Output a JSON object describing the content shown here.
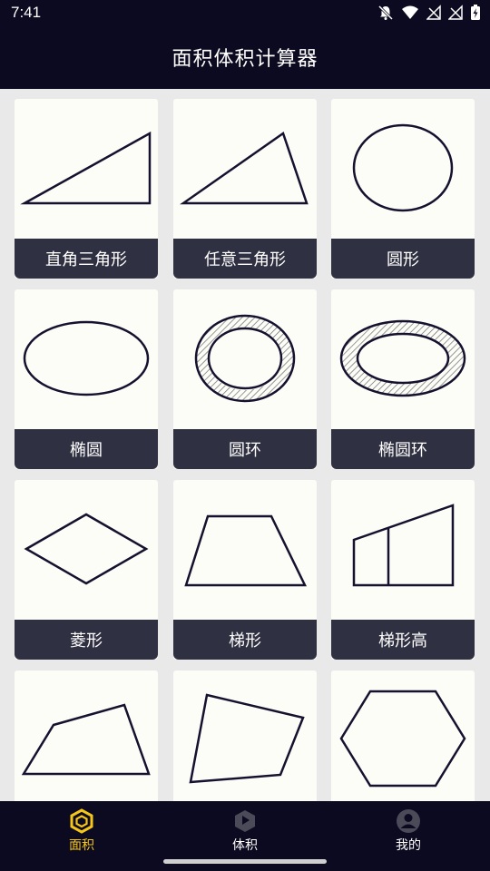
{
  "status": {
    "time": "7:41"
  },
  "header": {
    "title": "面积体积计算器"
  },
  "shapes": [
    {
      "label": "直角三角形",
      "icon": "right-triangle-icon"
    },
    {
      "label": "任意三角形",
      "icon": "triangle-icon"
    },
    {
      "label": "圆形",
      "icon": "circle-icon"
    },
    {
      "label": "椭圆",
      "icon": "ellipse-icon"
    },
    {
      "label": "圆环",
      "icon": "ring-icon"
    },
    {
      "label": "椭圆环",
      "icon": "ellipse-ring-icon"
    },
    {
      "label": "菱形",
      "icon": "rhombus-icon"
    },
    {
      "label": "梯形",
      "icon": "trapezoid-icon"
    },
    {
      "label": "梯形高",
      "icon": "trapezoid-height-icon"
    },
    {
      "label": "",
      "icon": "quadrilateral-icon"
    },
    {
      "label": "",
      "icon": "irregular-quadrilateral-icon"
    },
    {
      "label": "",
      "icon": "hexagon-icon"
    }
  ],
  "nav": {
    "area": "面积",
    "volume": "体积",
    "mine": "我的",
    "active_color": "#f5c518"
  }
}
